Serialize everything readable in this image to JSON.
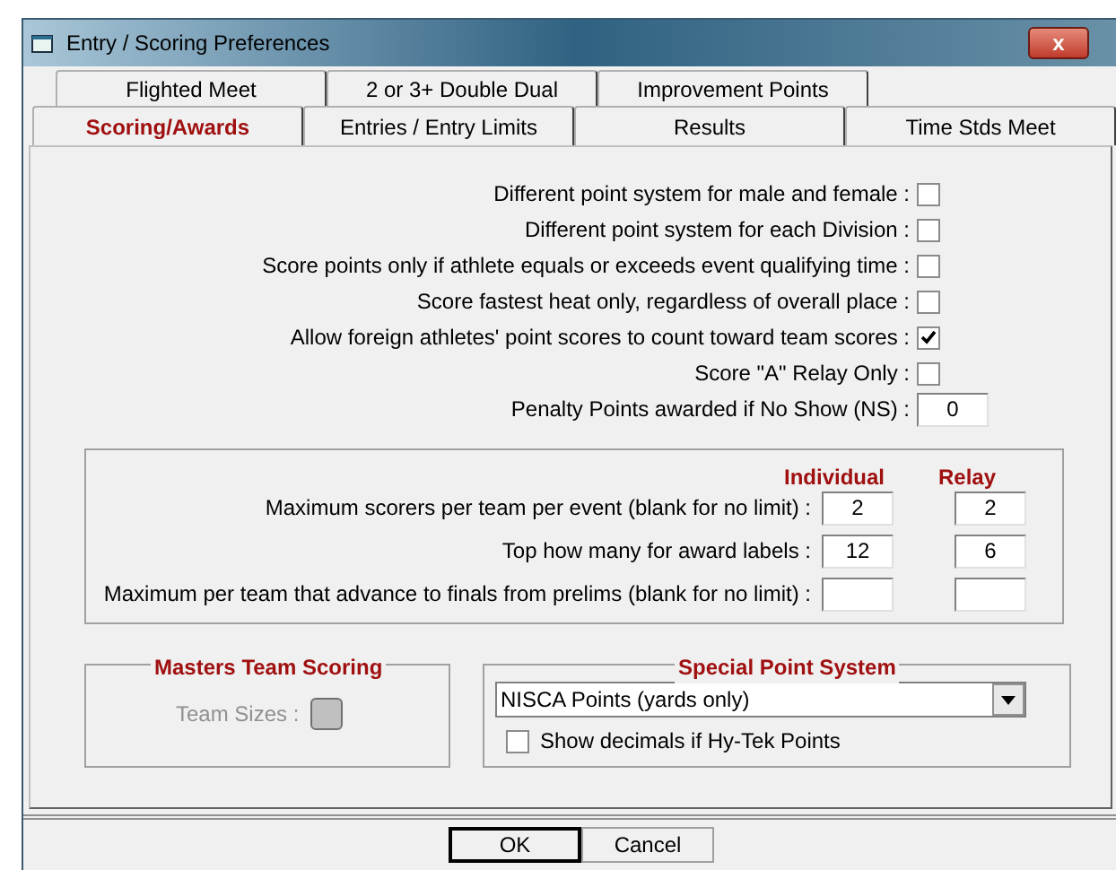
{
  "window": {
    "title": "Entry / Scoring Preferences",
    "close_label": "x"
  },
  "tabs_back": [
    {
      "label": "Flighted Meet",
      "selected": false
    },
    {
      "label": "2 or 3+ Double Dual",
      "selected": false
    },
    {
      "label": "Improvement Points",
      "selected": false
    }
  ],
  "tabs_front": [
    {
      "label": "Scoring/Awards",
      "selected": true
    },
    {
      "label": "Entries / Entry Limits",
      "selected": false
    },
    {
      "label": "Results",
      "selected": false
    },
    {
      "label": "Time Stds Meet",
      "selected": false
    }
  ],
  "options": [
    {
      "kind": "checkbox",
      "label": "Different point system for male and female :",
      "checked": false
    },
    {
      "kind": "checkbox",
      "label": "Different point system for each Division :",
      "checked": false
    },
    {
      "kind": "checkbox",
      "label": "Score points only if athlete equals or exceeds event qualifying time :",
      "checked": false
    },
    {
      "kind": "checkbox",
      "label": "Score fastest heat only, regardless of overall place :",
      "checked": false
    },
    {
      "kind": "checkbox",
      "label": "Allow foreign athletes' point scores to count toward team scores :",
      "checked": true
    },
    {
      "kind": "checkbox",
      "label": "Score \"A\" Relay Only :",
      "checked": false
    },
    {
      "kind": "number",
      "label": "Penalty Points awarded if No Show (NS) :",
      "value": "0"
    }
  ],
  "limits": {
    "columns": [
      "Individual",
      "Relay"
    ],
    "rows": [
      {
        "label": "Maximum scorers per team per event (blank for no limit) :",
        "individual": "2",
        "relay": "2"
      },
      {
        "label": "Top how many for award labels :",
        "individual": "12",
        "relay": "6"
      },
      {
        "label": "Maximum per team that advance to finals from prelims (blank for no limit) :",
        "individual": "",
        "relay": ""
      }
    ]
  },
  "masters": {
    "title": "Masters Team Scoring",
    "team_sizes_label": "Team Sizes :",
    "disabled": true
  },
  "special": {
    "title": "Special Point System",
    "selection": "NISCA Points (yards only)",
    "decimals_label": "Show decimals if Hy-Tek Points",
    "decimals_checked": false
  },
  "buttons": [
    "OK",
    "Cancel"
  ]
}
